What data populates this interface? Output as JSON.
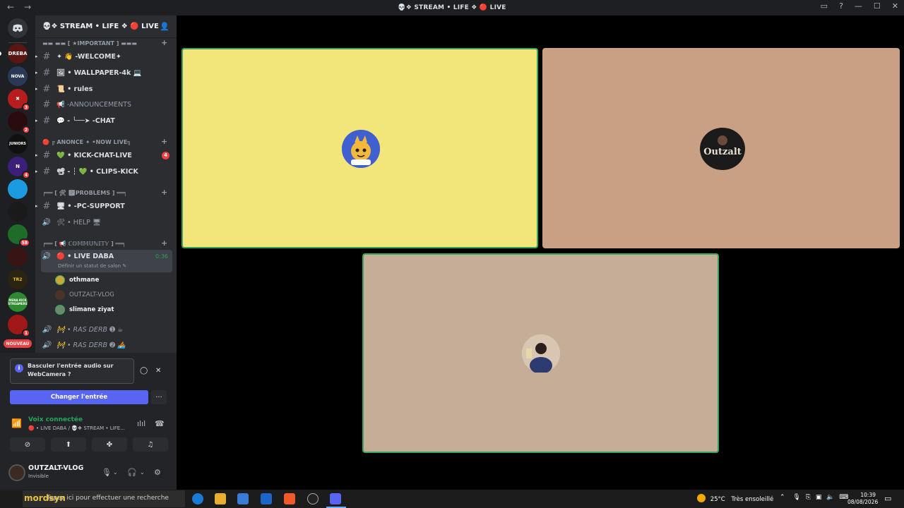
{
  "window": {
    "title": "💀❖ STREAM • LIFE ❖ 🔴 LIVE",
    "nav_back": "←",
    "nav_forward": "→"
  },
  "server": {
    "name": "💀❖ STREAM • LIFE ❖ 🔴 LIVE ⌄"
  },
  "guild_badges": [
    "3",
    "2",
    "4",
    "58",
    "1"
  ],
  "guild_labels": [
    "DREBA",
    "NOVA",
    "JUNIORS",
    "TR2",
    "MENA KICK STREAMERS",
    "NOUVEAU"
  ],
  "categories": [
    {
      "label": "▬▬ ▬▬ [ ★IMPORTANT ] ▬▬▬"
    },
    {
      "label": "🔴 ╔ ANONCE ✦ •NOW LIVE╗"
    },
    {
      "label": "╒══ [ 🛠 🅿PROBLEMS ] ══╕"
    },
    {
      "label": "╒══ [ 📢 ℂ𝕆𝕄𝕄𝕌ℕ𝕀𝕋𝕐 ] ══╕"
    }
  ],
  "channels": {
    "welcome": "✦ 👋 -WELCOME✦",
    "wallpaper": "🖼 • WALLPAPER-4k 💻",
    "rules": "📜 • rules",
    "announcements": "📢 -ANNOUNCEMENTS",
    "chat": "💬 - ╰──➤ -CHAT",
    "kick_chat": "💚 • KICK-CHAT-LIVE",
    "kick_chat_badge": "4",
    "clips": "📽 - ┆ 💚 • CLIPS-KICK",
    "pc_support": "🖥 • -PC-SUPPORT",
    "help": "🛠 • HELP 🖥",
    "live_daba": "🔴 • LIVE DABA",
    "live_daba_time": "0:36",
    "live_daba_status": "Définir un statut de salon ✎",
    "ras_derb_1": "🚧 • RAS DERB ➊ ☕",
    "ras_derb_2": "🚧 • RAS DERB ➋ 🚣"
  },
  "voice_users": [
    {
      "name": "othmane"
    },
    {
      "name": "OUTZALT-VLOG"
    },
    {
      "name": "slimane ziyat"
    }
  ],
  "prompt": {
    "text": "Basculer l'entrée audio sur WebCamera ?",
    "button": "Changer l'entrée",
    "more": "···"
  },
  "voice_connected": {
    "label": "Voix connectée",
    "where": "🔴 • LIVE DABA / 💀❖ STREAM • LIFE..."
  },
  "me": {
    "name": "OUTZALT-VLOG",
    "status": "Invisible"
  },
  "taskbar": {
    "search_brand": "mordsyn",
    "search_placeholder": "Tapez ici pour effectuer une recherche",
    "temperature": "25°C",
    "weather": "Très ensoleillé",
    "time": "10:39",
    "date": "08/08/2026"
  },
  "tile_labels": [
    "OUTZALT"
  ],
  "colors": {
    "accent": "#5865f2",
    "speaking": "#3ba55d",
    "tile1": "#f2e67a",
    "tile2": "#c9a084",
    "tile3": "#c6ad97"
  }
}
